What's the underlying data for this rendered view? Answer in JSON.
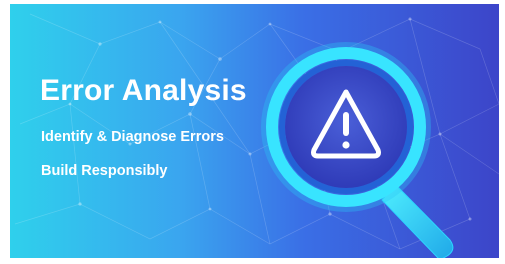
{
  "banner": {
    "title": "Error Analysis",
    "subtitle_1": "Identify & Diagnose Errors",
    "subtitle_2": "Build Responsibly",
    "icon": "warning-magnifier-icon",
    "colors": {
      "gradient_left": "#2fd0ec",
      "gradient_right": "#3c45c9",
      "ring_outer": "#33e0ff",
      "ring_inner": "#2566d9",
      "lens": "#3b49c8",
      "warning": "#ffffff"
    }
  }
}
